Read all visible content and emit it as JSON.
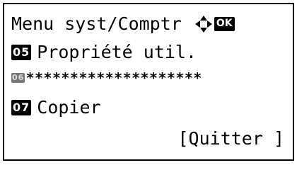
{
  "screen": {
    "title": "Menu syst/Comptr",
    "icons": {
      "navigation": "four-way-arrow-icon",
      "ok_label": "OK"
    },
    "items": [
      {
        "number": "05",
        "label": "Propriété util."
      },
      {
        "number": "06",
        "label": "********************"
      },
      {
        "number": "07",
        "label": "Copier"
      }
    ],
    "softkey": "[Quitter ]"
  }
}
